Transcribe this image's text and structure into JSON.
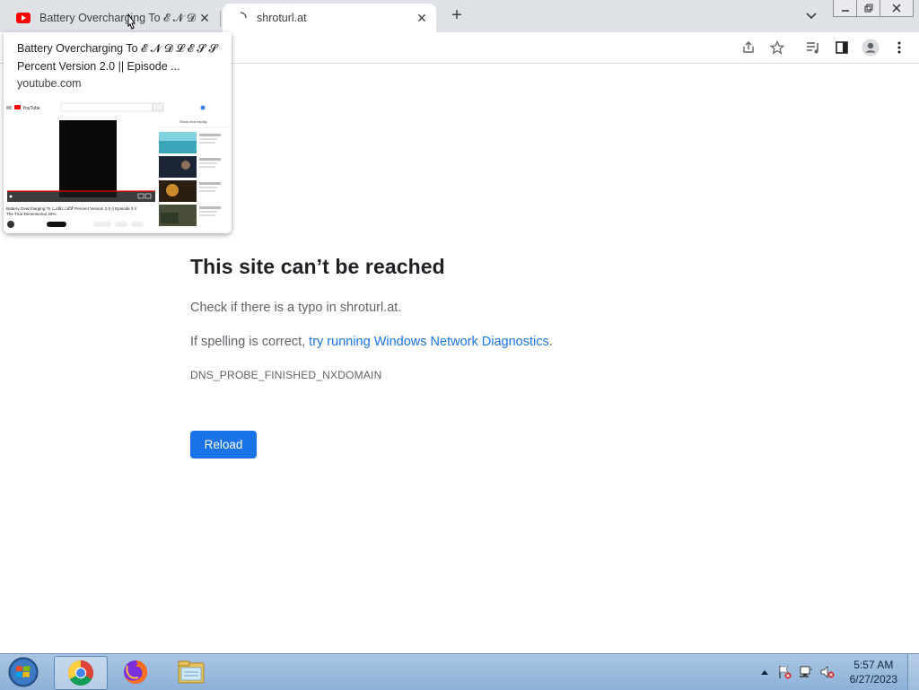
{
  "tabs": [
    {
      "title": "Battery Overcharging To 𝓔 𝓝 𝓓 𝓛",
      "favicon": "youtube-icon"
    },
    {
      "title": "shroturl.at",
      "favicon": "loading-icon"
    }
  ],
  "toolbar_icons": [
    "share-icon",
    "bookmark-star-icon",
    "media-control-icon",
    "side-panel-icon",
    "profile-icon",
    "menu-icon"
  ],
  "hover_card": {
    "title": "Battery Overcharging To 𝓔 𝓝 𝓓 𝓛 𝓔 𝓢 𝓢 Percent Version 2.0 || Episode ...",
    "domain": "youtube.com",
    "thumb_video_caption": "Battery Overcharging To 𝓔 𝓝 𝓓 𝓛 𝓔 𝓢 𝓢 Percent Version 2.0 || Episode 3 // The True Dimensional 40%",
    "thumb_logo": "YouTube",
    "thumb_show_chat": "Show chat replay"
  },
  "error": {
    "title": "This site can’t be reached",
    "line1_prefix": "Check if there is a typo in ",
    "line1_host": "shroturl.at",
    "line1_suffix": ".",
    "line2_prefix": "If spelling is correct, ",
    "line2_link": "try running Windows Network Diagnostics",
    "line2_suffix": ".",
    "code": "DNS_PROBE_FINISHED_NXDOMAIN",
    "reload_label": "Reload"
  },
  "taskbar": {
    "apps": [
      "start-orb-icon",
      "chrome-icon",
      "firefox-icon",
      "file-explorer-icon"
    ],
    "time": "5:57 AM",
    "date": "6/27/2023"
  },
  "colors": {
    "accent": "#1a73e8",
    "tabstrip": "#dee1e6",
    "taskbar": "#a9c5e3"
  }
}
